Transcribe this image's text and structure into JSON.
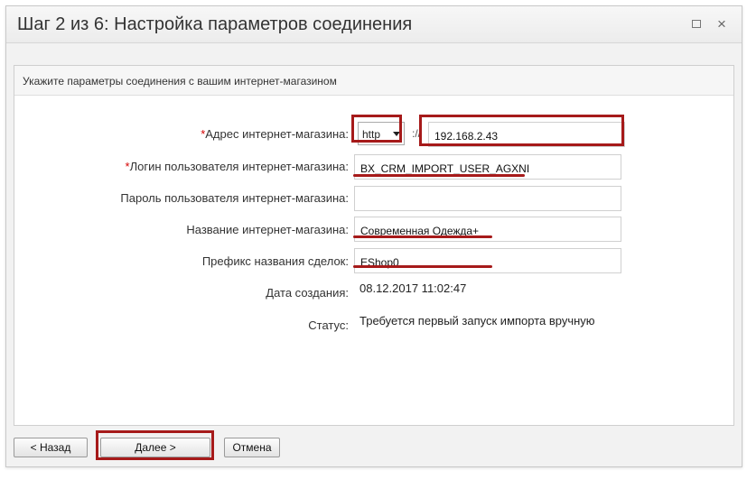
{
  "dialog": {
    "title": "Шаг 2 из 6: Настройка параметров соединения",
    "restore_label": "",
    "close_label": "×"
  },
  "form": {
    "intro": "Укажите параметры соединения с вашим интернет-магазином",
    "required_mark": "*",
    "address": {
      "label": "Адрес интернет-магазина:",
      "protocol": "http",
      "separator": "://",
      "host": "192.168.2.43"
    },
    "login": {
      "label": "Логин пользователя интернет-магазина:",
      "value": "BX_CRM_IMPORT_USER_AGXNI"
    },
    "password": {
      "label": "Пароль пользователя интернет-магазина:",
      "value": ""
    },
    "shop_name": {
      "label": "Название интернет-магазина:",
      "value": "Современная Одежда+"
    },
    "prefix": {
      "label": "Префикс названия сделок:",
      "value": "EShop0"
    },
    "created": {
      "label": "Дата создания:",
      "value": "08.12.2017 11:02:47"
    },
    "status": {
      "label": "Статус:",
      "value": "Требуется первый запуск импорта вручную"
    }
  },
  "buttons": {
    "back": "<  Назад",
    "next": "Далее      >",
    "cancel": "Отмена"
  },
  "annotation_color": "#a61a1a"
}
